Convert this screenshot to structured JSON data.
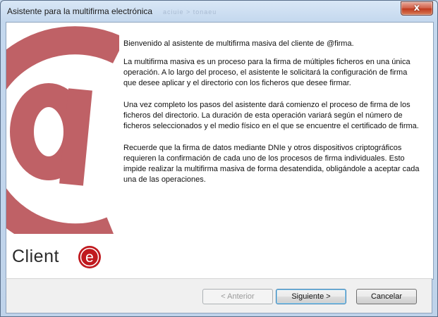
{
  "window": {
    "title": "Asistente para la multifirma electrónica",
    "background_ghost_text": "aciuie > tonaeu",
    "close_label": "x"
  },
  "logo": {
    "brand_text": "Client",
    "badge_letter": "e"
  },
  "intro": {
    "paragraphs": [
      "Bienvenido al asistente de multifirma masiva del cliente de @firma.",
      "La multifirma masiva es un proceso para la firma de múltiples ficheros en una única operación. A lo largo del proceso, el asistente le solicitará la configuración de firma que desee aplicar y el directorio con los ficheros que desee firmar.",
      "Una vez completo los pasos del asistente dará comienzo el proceso de firma de los ficheros del directorio. La duración de esta operación variará según el número de ficheros seleccionados y el medio físico en el que se encuentre el certificado de firma.",
      "Recuerde que la firma de datos mediante DNIe y otros dispositivos criptográficos requieren la confirmación de cada uno de los procesos de firma individuales. Esto impide realizar la multifirma masiva de forma desatendida, obligándole a aceptar cada una de las operaciones."
    ]
  },
  "buttons": {
    "back": "< Anterior",
    "next": "Siguiente >",
    "cancel": "Cancelar"
  },
  "colors": {
    "at_symbol": "#bf6166",
    "badge": "#c0191e",
    "titlebar": "#c4d8ee"
  }
}
